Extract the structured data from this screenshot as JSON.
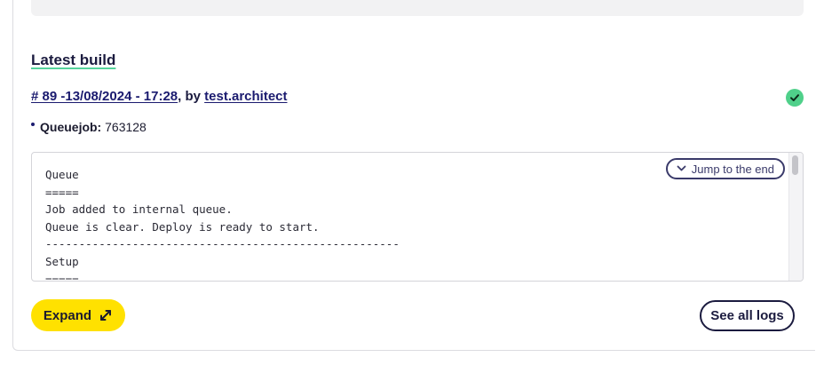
{
  "section": {
    "title": "Latest build"
  },
  "build": {
    "link_text": "# 89 -13/08/2024 - 17:28",
    "by_text": ", by ",
    "user": "test.architect",
    "status_icon": "check-circle-icon",
    "status_color": "#4fd08a"
  },
  "queue": {
    "label": "Queuejob:",
    "value": " 763128"
  },
  "log": {
    "content": "Queue\n=====\nJob added to internal queue.\nQueue is clear. Deploy is ready to start.\n-----------------------------------------------------\nSetup\n=====",
    "jump_label": "Jump to the end",
    "jump_icon": "chevron-down-icon"
  },
  "actions": {
    "expand_label": "Expand",
    "expand_icon": "expand-arrows-icon",
    "expand_color": "#ffe100",
    "see_logs_label": "See all logs"
  }
}
